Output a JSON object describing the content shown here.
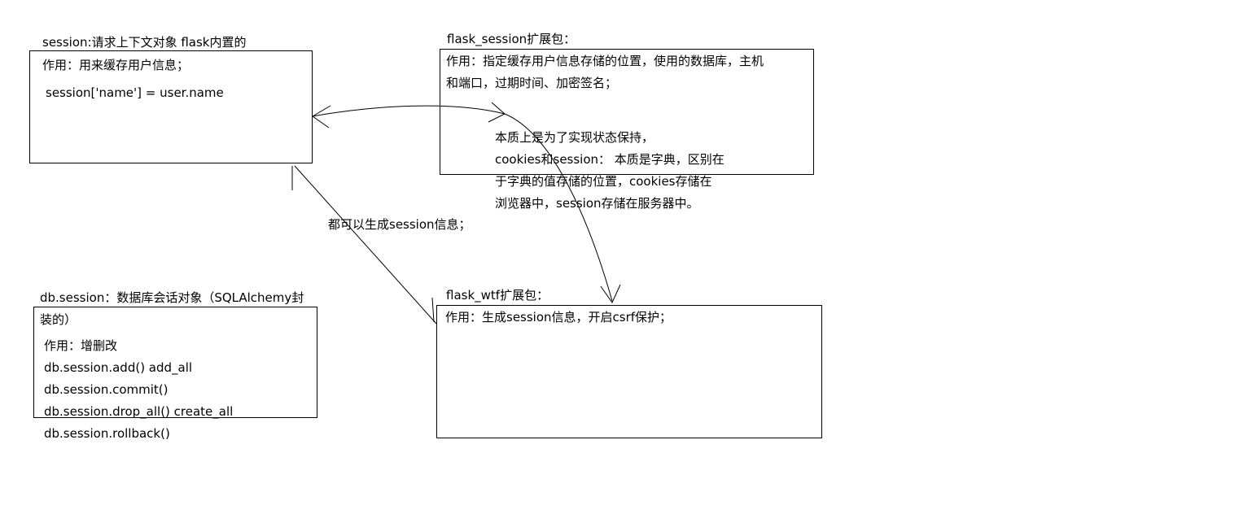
{
  "session_box": {
    "title": "session:请求上下文对象   flask内置的",
    "lines": [
      "作用：用来缓存用户信息；",
      "session['name'] = user.name"
    ]
  },
  "flask_session_box": {
    "title": "flask_session扩展包：",
    "lines": [
      "作用：指定缓存用户信息存储的位置，使用的数据库，主机",
      "和端口，过期时间、加密签名；"
    ]
  },
  "note": {
    "lines": [
      "本质上是为了实现状态保持，",
      "cookies和session： 本质是字典，区别在",
      "于字典的值存储的位置，cookies存储在",
      "浏览器中，session存储在服务器中。"
    ]
  },
  "arrow_label": "都可以生成session信息；",
  "db_session_box": {
    "title": "db.session：数据库会话对象（SQLAlchemy封",
    "lines": [
      "装的）",
      "作用：增删改",
      "db.session.add()  add_all",
      "db.session.commit()",
      "db.session.drop_all() create_all",
      "db.session.rollback()"
    ]
  },
  "flask_wtf_box": {
    "title": "flask_wtf扩展包：",
    "lines": [
      "作用：生成session信息，开启csrf保护；"
    ]
  },
  "colors": {
    "stroke": "#000000",
    "background": "#ffffff"
  }
}
